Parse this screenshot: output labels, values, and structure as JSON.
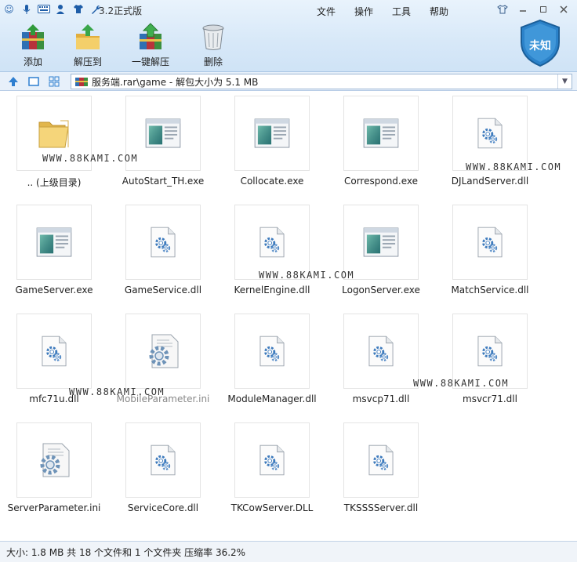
{
  "quick_icons": [
    "smiley-icon",
    "microphone-icon",
    "keyboard-icon",
    "user-icon",
    "shirt-icon",
    "wrench-icon"
  ],
  "app_title": "3.2正式版",
  "menu": [
    "文件",
    "操作",
    "工具",
    "帮助"
  ],
  "window_controls": [
    "skin-icon",
    "minimize-icon",
    "restore-icon",
    "close-icon"
  ],
  "toolbar": {
    "add": "添加",
    "extract": "解压到",
    "one_click_extract": "一键解压",
    "delete": "删除"
  },
  "badge": "未知",
  "address": {
    "path": "服务端.rar\\game - 解包大小为 5.1 MB"
  },
  "files": [
    {
      "name": ".. (上级目录)",
      "type": "folder"
    },
    {
      "name": "AutoStart_TH.exe",
      "type": "exe"
    },
    {
      "name": "Collocate.exe",
      "type": "exe"
    },
    {
      "name": "Correspond.exe",
      "type": "exe"
    },
    {
      "name": "DJLandServer.dll",
      "type": "dll"
    },
    {
      "name": "GameServer.exe",
      "type": "exe"
    },
    {
      "name": "GameService.dll",
      "type": "dll"
    },
    {
      "name": "KernelEngine.dll",
      "type": "dll"
    },
    {
      "name": "LogonServer.exe",
      "type": "exe"
    },
    {
      "name": "MatchService.dll",
      "type": "dll"
    },
    {
      "name": "mfc71u.dll",
      "type": "dll"
    },
    {
      "name": "MobileParameter.ini",
      "type": "ini"
    },
    {
      "name": "ModuleManager.dll",
      "type": "dll"
    },
    {
      "name": "msvcp71.dll",
      "type": "dll"
    },
    {
      "name": "msvcr71.dll",
      "type": "dll"
    },
    {
      "name": "ServerParameter.ini",
      "type": "ini"
    },
    {
      "name": "ServiceCore.dll",
      "type": "dll"
    },
    {
      "name": "TKCowServer.DLL",
      "type": "dll"
    },
    {
      "name": "TKSSSServer.dll",
      "type": "dll"
    }
  ],
  "watermarks": [
    "WWW.88KAMI.COM",
    "WWW.88KAMI.COM",
    "WWW.88KAMI.COM",
    "WWW.88KAMI.COM",
    "WWW.88KAMI.COM"
  ],
  "status": "大小: 1.8 MB 共 18 个文件和 1 个文件夹 压缩率 36.2%",
  "colors": {
    "toolbar_bg": "#d7e8f8",
    "badge_blue": "#2b82c9",
    "accent": "#1e5da8"
  }
}
